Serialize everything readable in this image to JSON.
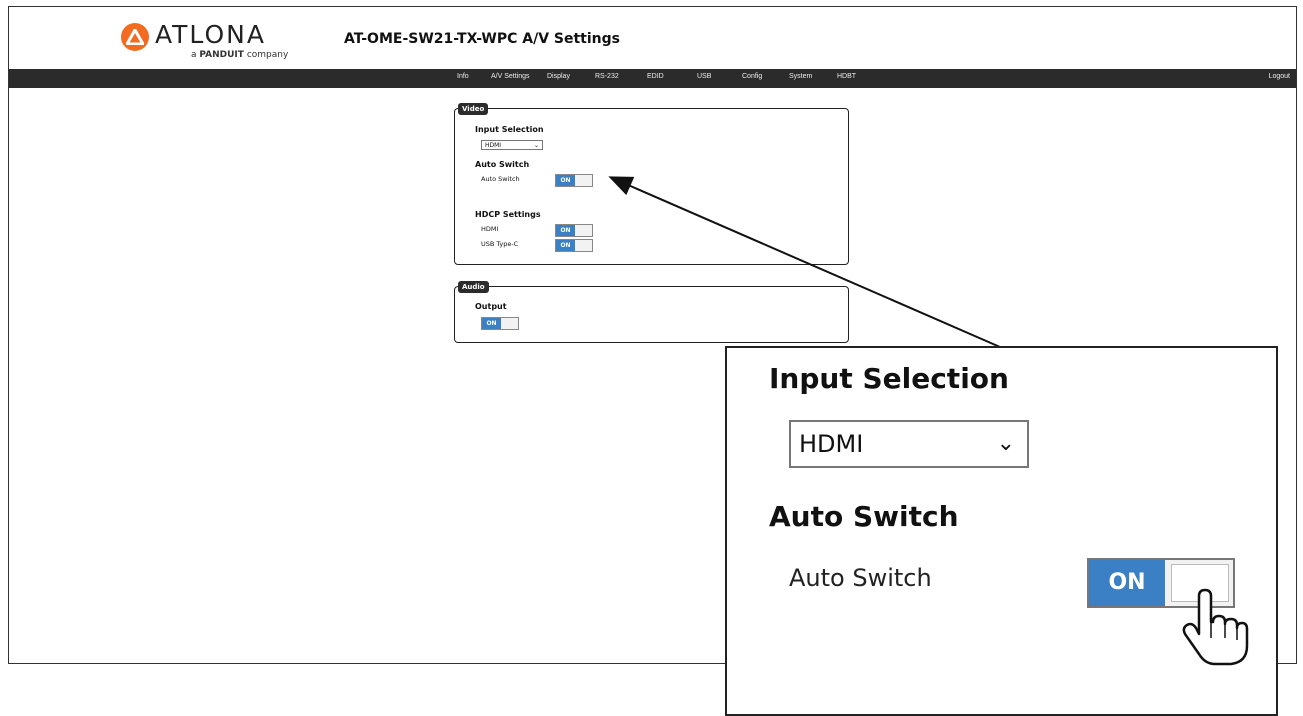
{
  "brand": {
    "logo_text": "ATLONA",
    "logo_sub_prefix": "a",
    "logo_sub_brand": "PANDUIT",
    "logo_sub_suffix": "company",
    "accent": "#f26b21"
  },
  "page_title": "AT-OME-SW21-TX-WPC  A/V Settings",
  "nav": {
    "items": [
      "Info",
      "A/V Settings",
      "Display",
      "RS-232",
      "EDID",
      "USB",
      "Config",
      "System",
      "HDBT"
    ],
    "logout": "Logout"
  },
  "video": {
    "legend": "Video",
    "input_selection_heading": "Input Selection",
    "input_selection_value": "HDMI",
    "auto_switch_heading": "Auto Switch",
    "auto_switch_label": "Auto Switch",
    "auto_switch_state": "ON",
    "hdcp_heading": "HDCP Settings",
    "hdcp_hdmi_label": "HDMI",
    "hdcp_hdmi_state": "ON",
    "hdcp_usbc_label": "USB Type-C",
    "hdcp_usbc_state": "ON"
  },
  "audio": {
    "legend": "Audio",
    "output_heading": "Output",
    "output_state": "ON"
  },
  "zoom": {
    "input_selection_heading": "Input Selection",
    "input_selection_value": "HDMI",
    "auto_switch_heading": "Auto Switch",
    "auto_switch_label": "Auto Switch",
    "auto_switch_state": "ON"
  },
  "colors": {
    "toggle_on": "#3b80c4",
    "navbar": "#2b2b2b"
  },
  "icons": [
    "chevron-down-icon",
    "hand-pointer-icon",
    "arrow-pointer-icon"
  ]
}
